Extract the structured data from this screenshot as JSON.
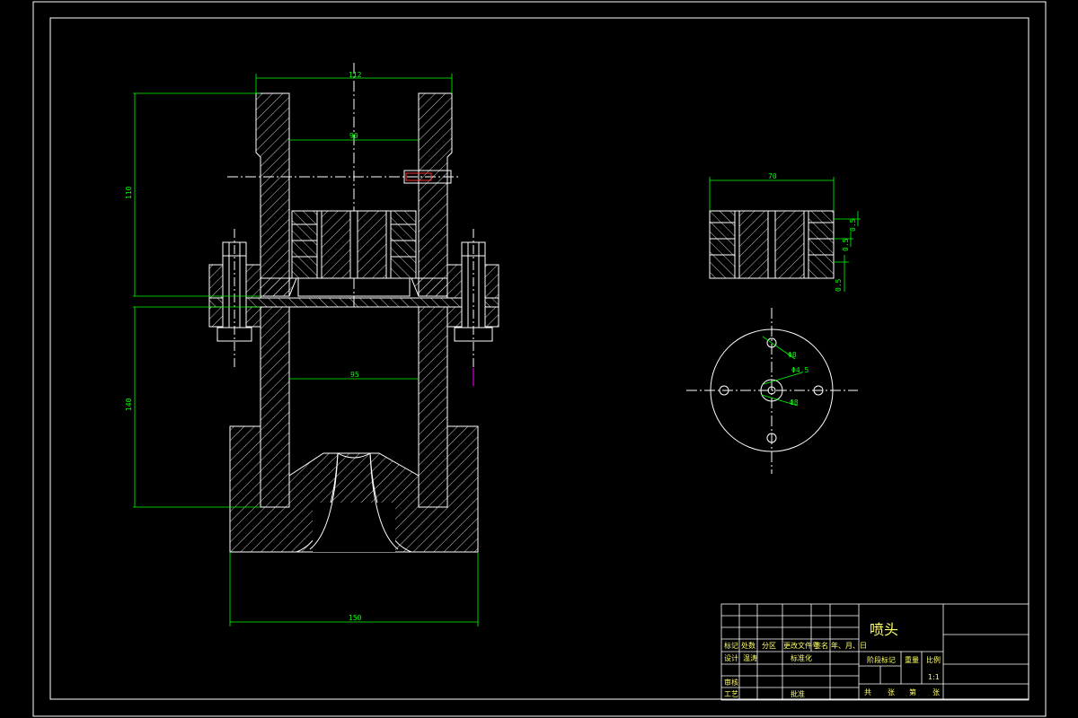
{
  "colors": {
    "background": "#000000",
    "outline": "#ffffff",
    "dimension": "#00ff00",
    "titleblock_text": "#ffff66",
    "highlight": "#ff3333",
    "marker": "#ff00ff"
  },
  "dimensions": {
    "top_width": "112",
    "inner_top": "90",
    "upper_height": "110",
    "lower_height": "140",
    "inner_lower": "95",
    "base_width": "150",
    "side_view_width": "70",
    "side_view_a": "0.5",
    "side_view_b": "0.5",
    "side_view_c": "0.5",
    "hole_a": "Φ8",
    "hole_b": "Φ4.5",
    "hole_c": "Φ8"
  },
  "title_block": {
    "drawing_name": "喷头",
    "designer": "温涛",
    "headers": [
      "标记",
      "处数",
      "分区",
      "更改文件号",
      "签名",
      "年、月、日"
    ],
    "row_labels": [
      "设计",
      "审核",
      "工艺"
    ],
    "standardization": "标准化",
    "approval": "批准",
    "stage_mark": "阶段标记",
    "weight": "重量",
    "scale_label": "比例",
    "scale_value": "1:1",
    "sheet_info": [
      "共",
      "张",
      "第",
      "张"
    ]
  }
}
